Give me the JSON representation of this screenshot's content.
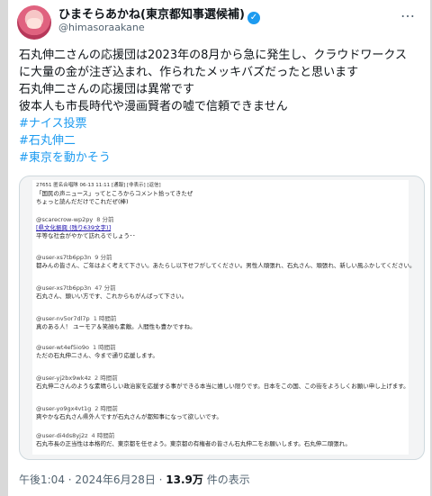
{
  "tweet": {
    "display_name": "ひまそらあかね(東京都知事選候補)",
    "handle": "@himasoraakane",
    "more": "…",
    "lines": [
      "石丸伸二さんの応援団は2023年の8月から急に発生し、クラウドワークス",
      "に大量の金が注ぎ込まれ、作られたメッキバズだったと思います",
      "石丸伸二さんの応援団は異常です",
      "彼本人も市長時代や漫画賢者の嘘で信頼できません"
    ],
    "hashtags": [
      "#ナイス投票",
      "#石丸伸二",
      "#東京を動かそう"
    ],
    "time": "午後1:04 · 2024年6月28日 · ",
    "views": "13.9万",
    "views_suffix": " 件の表示"
  },
  "embed": {
    "header": "27651 匿名合唱隊 06-13 11:11 [通報] [非表示] [返信]",
    "intro": [
      "「国民の声ニュース」ってところからコメント拾ってきたぜ",
      "ちょっと読んだだけでこれだぜ(棒)"
    ],
    "comments": [
      {
        "user": "@scarecrow-wp2py",
        "time": "8 分前",
        "link": "[県文化振興 (残り639文字)]",
        "text": "平等な社会がやかて訪れるでしょう･･"
      },
      {
        "user": "@user-xs7tb6pp3n",
        "time": "9 分前",
        "text": "都みんの皆さん、ご年はよく考えて下さい。あたらし以下せフがしてください。男性人頑張れ、石丸さん、頑張れ、新しい風ふかしてください。"
      },
      {
        "user": "@user-xs7tb6pp3n",
        "time": "47 分前",
        "text": "石丸さん、頭いい方です、これからもがんばって下さい。"
      },
      {
        "user": "@user-nv5or7dl7p",
        "time": "1 時間前",
        "text": "真のある人！ ユーモア＆笑顔も素敵。人間性も豊かですね。"
      },
      {
        "user": "@user-wt4ef5io9o",
        "time": "1 時間前",
        "text": "ただの石丸伸二さん、今まで通り応援します。"
      },
      {
        "user": "@user-yj2bx9wk4z",
        "time": "2 時間前",
        "text": "石丸伸二さんのような素晴らしい政治家を応援する事ができる本当に嬉しい限りです。日本をこの国、この街をよろしくお願い申し上げます。"
      },
      {
        "user": "@user-yo9gx4vt1g",
        "time": "2 時間前",
        "text": "爽やかな石丸さん県外人ですが石丸さんが都知事になって欲しいです。"
      },
      {
        "user": "@user-di4ds8yj2z",
        "time": "4 時間前",
        "text": "石丸市長の正当性は本格的だ、東京都を任せよう。東京都の有権者の皆さん石丸伸二をお願いします。石丸伸二頑張れ。"
      }
    ]
  }
}
